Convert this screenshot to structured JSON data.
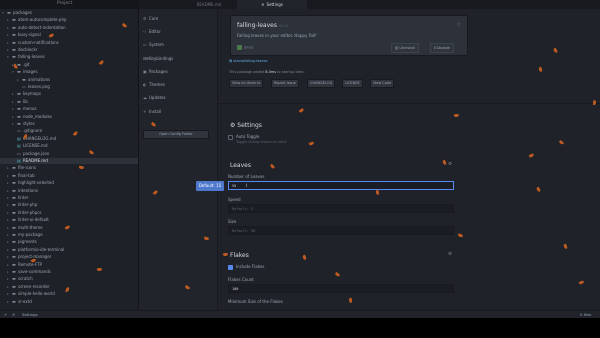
{
  "window": {
    "title": "Project"
  },
  "tabs": [
    {
      "label": "README.md"
    },
    {
      "label": "Settings"
    }
  ],
  "tree": {
    "items": [
      {
        "label": "packages",
        "type": "folder",
        "depth": 0,
        "expanded": true
      },
      {
        "label": "atom-autocomplete-php",
        "type": "folder",
        "depth": 1
      },
      {
        "label": "auto-detect-indentation",
        "type": "folder",
        "depth": 1
      },
      {
        "label": "busy-signal",
        "type": "folder",
        "depth": 1
      },
      {
        "label": "custom-notifications",
        "type": "folder",
        "depth": 1
      },
      {
        "label": "docblockr",
        "type": "folder",
        "depth": 1
      },
      {
        "label": "falling-leaves",
        "type": "folder",
        "depth": 1,
        "expanded": true
      },
      {
        "label": ".git",
        "type": "folder",
        "depth": 2
      },
      {
        "label": "images",
        "type": "folder",
        "depth": 2,
        "expanded": true
      },
      {
        "label": "animations",
        "type": "folder",
        "depth": 3
      },
      {
        "label": "leaves.png",
        "type": "file",
        "depth": 3
      },
      {
        "label": "keymaps",
        "type": "folder",
        "depth": 2
      },
      {
        "label": "lib",
        "type": "folder",
        "depth": 2
      },
      {
        "label": "menus",
        "type": "folder",
        "depth": 2
      },
      {
        "label": "node_modules",
        "type": "folder",
        "depth": 2
      },
      {
        "label": "styles",
        "type": "folder",
        "depth": 2
      },
      {
        "label": ".gitignore",
        "type": "file",
        "depth": 2
      },
      {
        "label": "CHANGELOG.md",
        "type": "md",
        "depth": 2
      },
      {
        "label": "LICENSE.md",
        "type": "md",
        "depth": 2
      },
      {
        "label": "package.json",
        "type": "file",
        "depth": 2
      },
      {
        "label": "README.md",
        "type": "md",
        "depth": 2,
        "selected": true
      },
      {
        "label": "file-icons",
        "type": "folder",
        "depth": 1
      },
      {
        "label": "final-tab",
        "type": "folder",
        "depth": 1
      },
      {
        "label": "highlight-selected",
        "type": "folder",
        "depth": 1
      },
      {
        "label": "intentions",
        "type": "folder",
        "depth": 1
      },
      {
        "label": "linter",
        "type": "folder",
        "depth": 1
      },
      {
        "label": "linter-php",
        "type": "folder",
        "depth": 1
      },
      {
        "label": "linter-phpcs",
        "type": "folder",
        "depth": 1
      },
      {
        "label": "linter-ui-default",
        "type": "folder",
        "depth": 1
      },
      {
        "label": "multi-theme",
        "type": "folder",
        "depth": 1
      },
      {
        "label": "my-package",
        "type": "folder",
        "depth": 1
      },
      {
        "label": "pigments",
        "type": "folder",
        "depth": 1
      },
      {
        "label": "platformio-ide-terminal",
        "type": "folder",
        "depth": 1
      },
      {
        "label": "project-manager",
        "type": "folder",
        "depth": 1
      },
      {
        "label": "Remote-FTP",
        "type": "folder",
        "depth": 1
      },
      {
        "label": "save-commands",
        "type": "folder",
        "depth": 1
      },
      {
        "label": "scratch",
        "type": "folder",
        "depth": 1
      },
      {
        "label": "screen-recorder",
        "type": "folder",
        "depth": 1
      },
      {
        "label": "simple-hello-world",
        "type": "folder",
        "depth": 1
      },
      {
        "label": "sr-extd",
        "type": "folder",
        "depth": 1
      }
    ]
  },
  "settings_nav": {
    "items": [
      {
        "label": "Core",
        "icon": "settings-icon"
      },
      {
        "label": "Editor",
        "icon": "code-icon"
      },
      {
        "label": "System",
        "icon": "device-desktop-icon"
      },
      {
        "label": "Keybindings",
        "icon": "keyboard-icon"
      },
      {
        "label": "Packages",
        "icon": "package-icon"
      },
      {
        "label": "Themes",
        "icon": "paintcan-icon"
      },
      {
        "label": "Updates",
        "icon": "cloud-download-icon"
      },
      {
        "label": "Install",
        "icon": "plus-icon"
      }
    ],
    "open_config": "Open Config Folder"
  },
  "package": {
    "name": "falling-leaves",
    "version": "0.0.0",
    "description": "Falling leaves in your editor. Happy Fall!",
    "author": "pinos",
    "uninstall_label": "Uninstall",
    "disable_label": "Disable",
    "repo_link": "stevo/falling-leaves",
    "load_time_prefix": "This package added",
    "load_time_value": "8.0ms",
    "load_time_suffix": "to startup time.",
    "buttons": [
      "View on Atom.io",
      "Report Issue",
      "CHANGELOG",
      "LICENSE",
      "View Code"
    ]
  },
  "settings": {
    "title": "Settings",
    "auto_toggle_label": "Auto Toggle",
    "auto_toggle_desc": "Toggle falling leaves on start",
    "leaves_section": "Leaves",
    "number_label": "Number of Leaves",
    "number_value": "55",
    "default_tip": "Default: 15",
    "speed_label": "Speed",
    "speed_placeholder": "Default: 5",
    "size_label": "Size",
    "size_placeholder": "Default: 90",
    "flakes_section": "Flakes",
    "include_flakes_label": "Include Flakes",
    "flakes_count_label": "Flakes Count",
    "flakes_count_value": "100",
    "min_size_label": "Minimum Size of the Flakes"
  },
  "statusbar": {
    "left": "Settings",
    "right": "0 files"
  },
  "colors": {
    "accent": "#568af2",
    "leaf": "#d9641e",
    "link": "#61afef"
  }
}
